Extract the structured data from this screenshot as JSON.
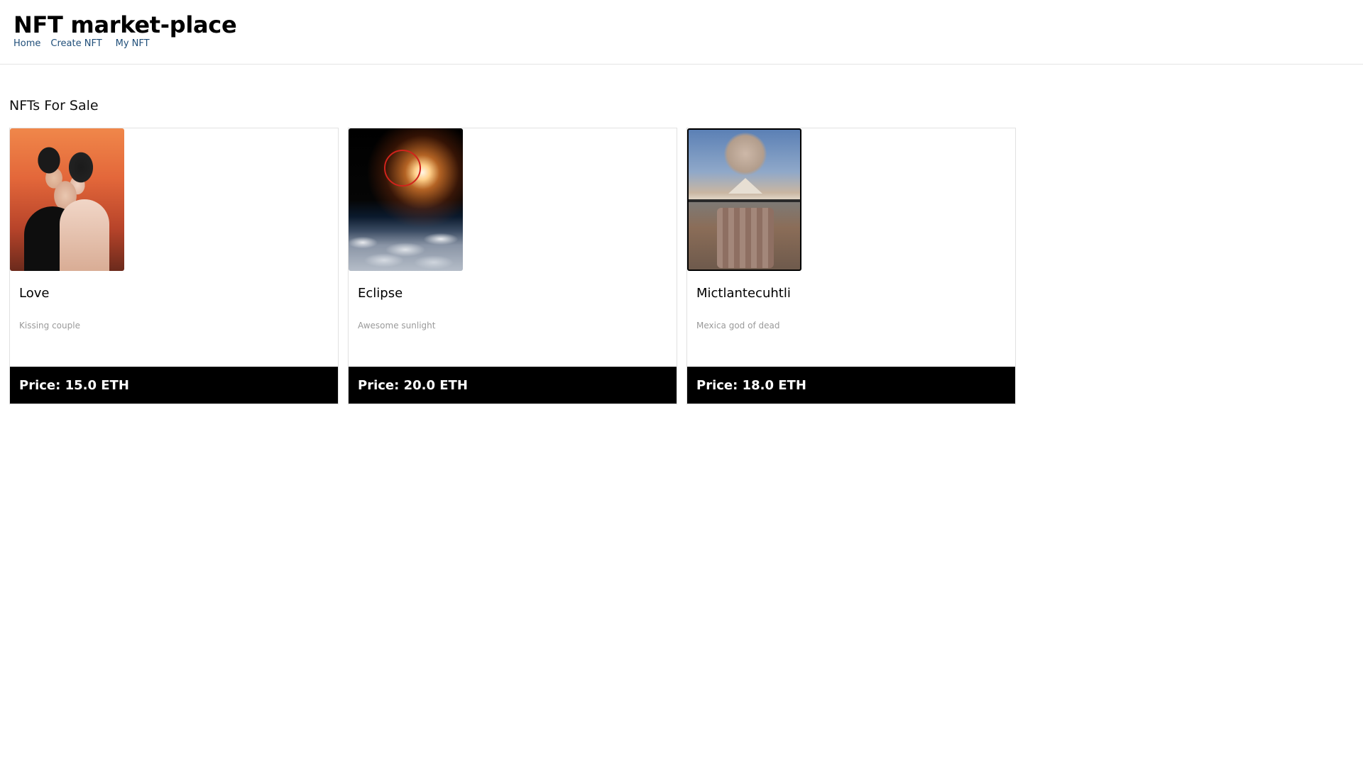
{
  "app": {
    "brand": "NFT market-place"
  },
  "nav": {
    "items": [
      {
        "label": "Home"
      },
      {
        "label": "Create NFT"
      },
      {
        "label": "My NFT"
      }
    ]
  },
  "main": {
    "section_title": "NFTs For Sale",
    "cards": [
      {
        "name": "Love",
        "description": "Kissing couple",
        "price": "Price: 15.0 ETH",
        "image": "kissing-couple-painting"
      },
      {
        "name": "Eclipse",
        "description": "Awesome sunlight",
        "price": "Price: 20.0 ETH",
        "image": "eclipse-over-clouds"
      },
      {
        "name": "Mictlantecuhtli",
        "description": "Mexica god of dead",
        "price": "Price: 18.0 ETH",
        "image": "mexica-god-collage"
      }
    ]
  }
}
